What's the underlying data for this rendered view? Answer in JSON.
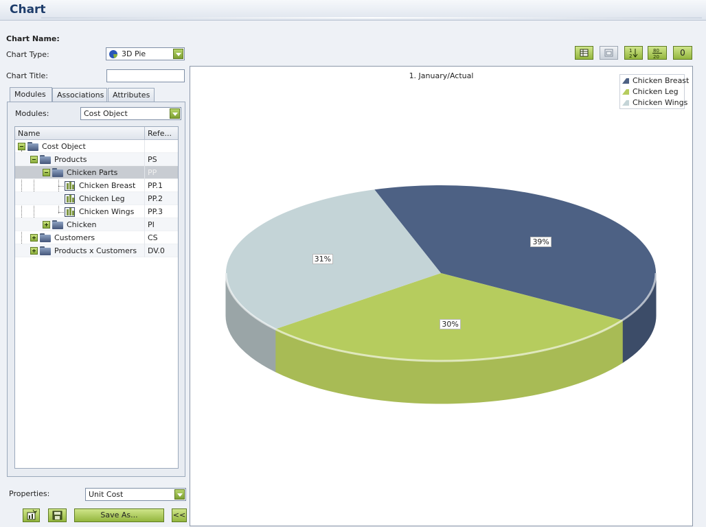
{
  "window": {
    "title": "Chart"
  },
  "form": {
    "chart_name_label": "Chart Name:",
    "chart_type_label": "Chart Type:",
    "chart_type_value": "3D Pie",
    "chart_title_label": "Chart Title:",
    "chart_title_value": ""
  },
  "tabs": [
    {
      "label": "Modules",
      "active": true
    },
    {
      "label": "Associations",
      "active": false
    },
    {
      "label": "Attributes",
      "active": false
    }
  ],
  "modules": {
    "label": "Modules:",
    "value": "Cost Object"
  },
  "tree": {
    "columns": [
      "Name",
      "Refe..."
    ],
    "rows": [
      {
        "name": "Cost Object",
        "ref": "",
        "level": 0,
        "toggle": "minus",
        "icon": "folder-icon"
      },
      {
        "name": "Products",
        "ref": "PS",
        "level": 1,
        "toggle": "minus",
        "icon": "folder-icon"
      },
      {
        "name": "Chicken Parts",
        "ref": "PP",
        "level": 2,
        "toggle": "minus",
        "icon": "folder-icon",
        "selected": true
      },
      {
        "name": "Chicken Breast",
        "ref": "PP.1",
        "level": 3,
        "toggle": "",
        "icon": "chart-icon"
      },
      {
        "name": "Chicken Leg",
        "ref": "PP.2",
        "level": 3,
        "toggle": "",
        "icon": "chart-icon"
      },
      {
        "name": "Chicken Wings",
        "ref": "PP.3",
        "level": 3,
        "toggle": "",
        "icon": "chart-icon"
      },
      {
        "name": "Chicken",
        "ref": "PI",
        "level": 2,
        "toggle": "plus",
        "icon": "folder-icon"
      },
      {
        "name": "Customers",
        "ref": "CS",
        "level": 1,
        "toggle": "plus",
        "icon": "folder-icon"
      },
      {
        "name": "Products x Customers",
        "ref": "DV.0",
        "level": 1,
        "toggle": "plus",
        "icon": "folder-icon"
      }
    ]
  },
  "properties": {
    "label": "Properties:",
    "value": "Unit Cost"
  },
  "bottom_buttons": {
    "save_as": "Save As...",
    "collapse": "<<"
  },
  "toolbar": {
    "sort_label": "1 2",
    "ratio_label": "80 20",
    "zero_label": "0"
  },
  "chart_data": {
    "type": "pie",
    "style": "3d",
    "title": "1. January/Actual",
    "legend_position": "top-right",
    "categories": [
      "Chicken Breast",
      "Chicken Leg",
      "Chicken Wings"
    ],
    "values": [
      39,
      30,
      31
    ],
    "labels": [
      "39%",
      "30%",
      "31%"
    ],
    "colors": [
      "#4d6184",
      "#b6cc5e",
      "#c4d4d7"
    ],
    "side_colors": [
      "#3c4c68",
      "#a8bb55",
      "#9aa5a7"
    ]
  }
}
